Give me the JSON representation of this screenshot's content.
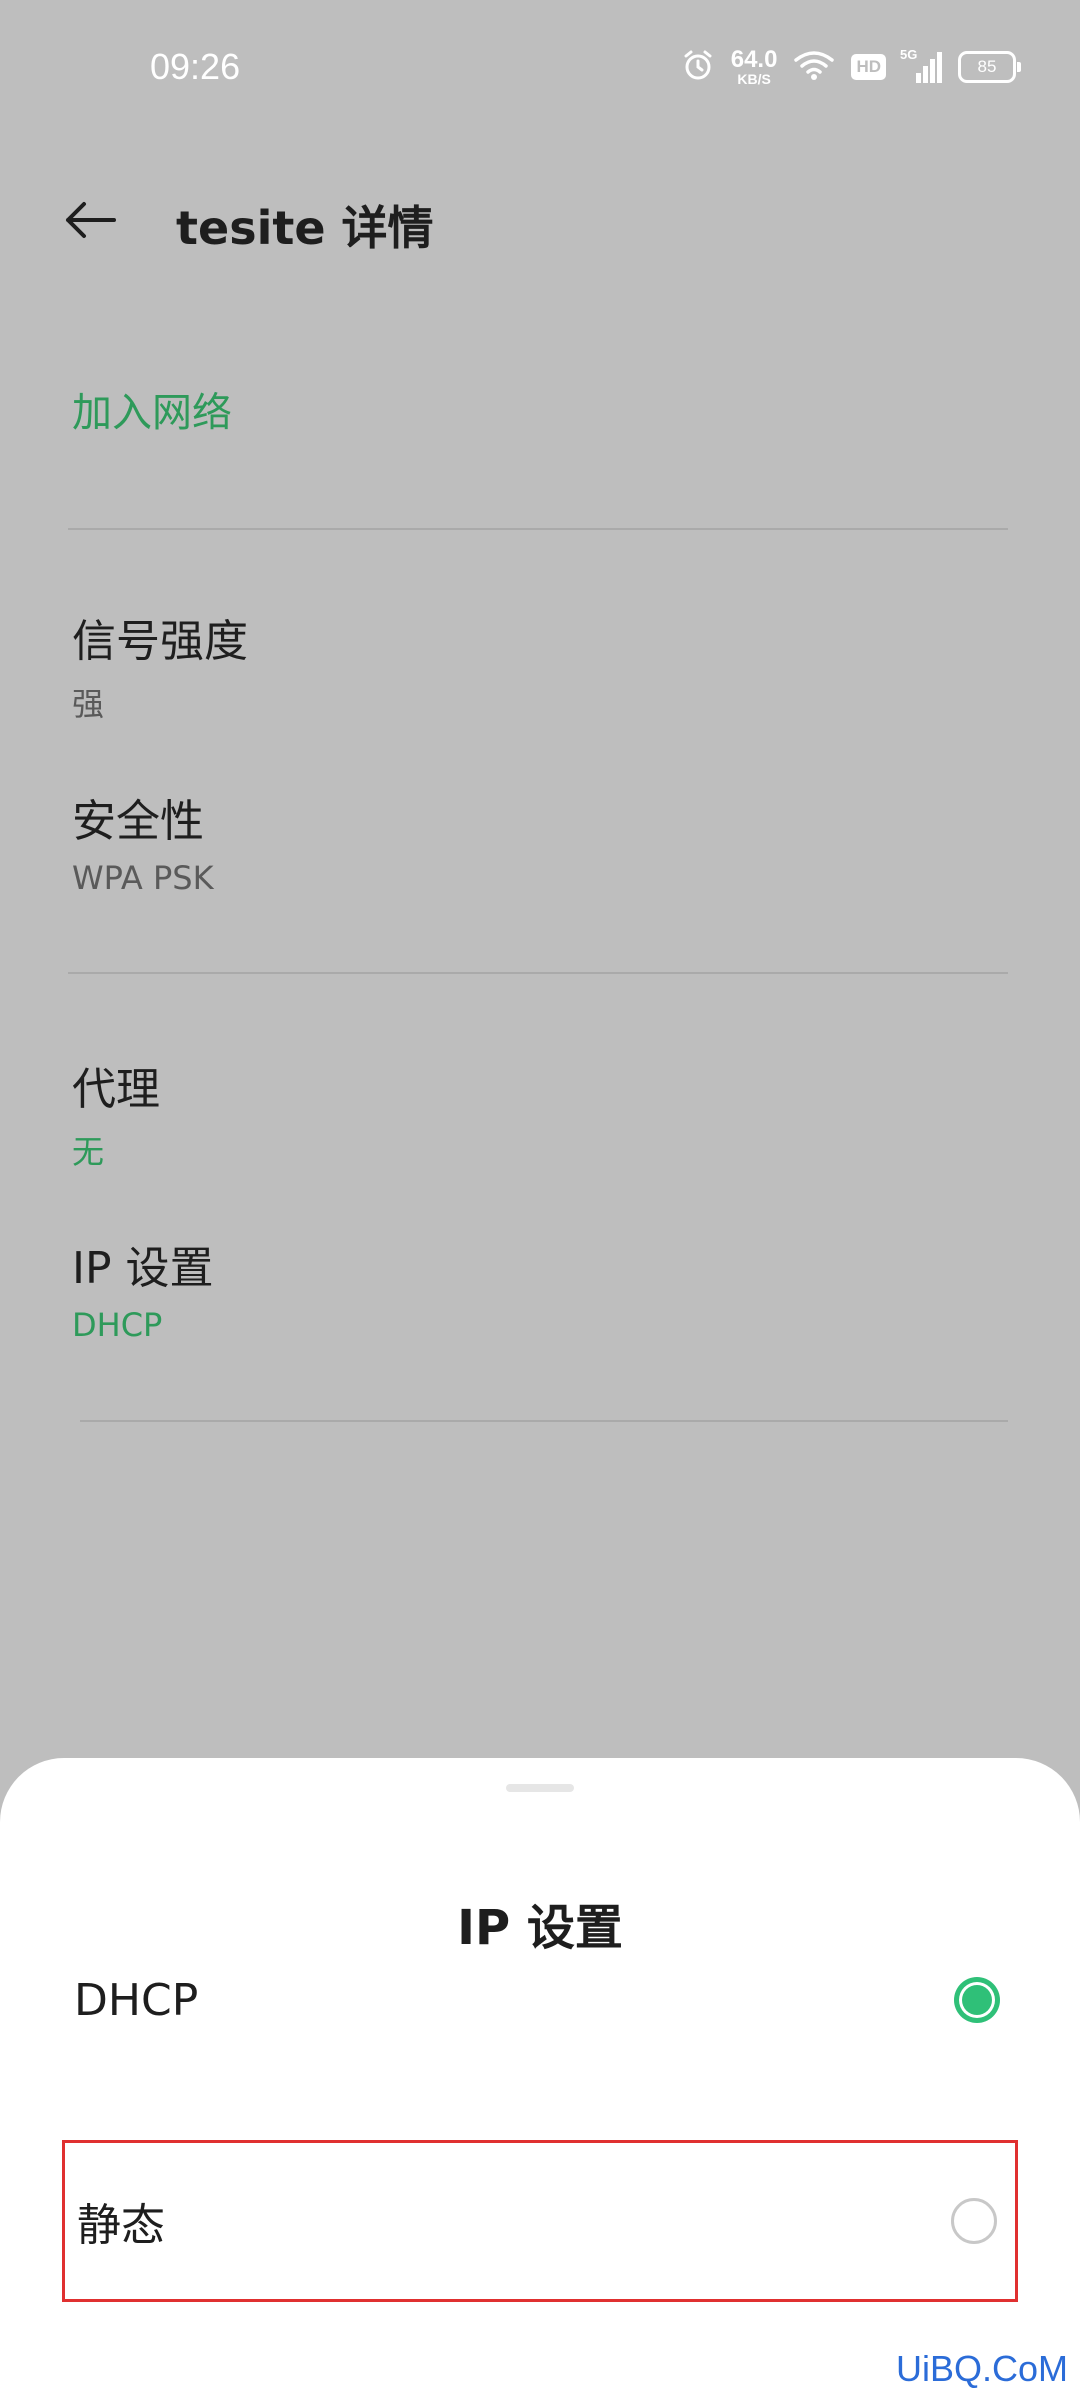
{
  "status_bar": {
    "time": "09:26",
    "net_speed_value": "64.0",
    "net_speed_unit": "KB/S",
    "hd_badge": "HD",
    "network_type": "5G",
    "battery_level": "85"
  },
  "header": {
    "title": "tesite 详情"
  },
  "actions": {
    "join_network": "加入网络"
  },
  "details": {
    "signal_strength": {
      "label": "信号强度",
      "value": "强"
    },
    "security": {
      "label": "安全性",
      "value": "WPA PSK"
    },
    "proxy": {
      "label": "代理",
      "value": "无"
    },
    "ip_settings": {
      "label": "IP 设置",
      "value": "DHCP"
    }
  },
  "sheet": {
    "title": "IP 设置",
    "options": [
      {
        "label": "DHCP",
        "selected": true
      },
      {
        "label": "静态",
        "selected": false
      }
    ]
  },
  "watermark": "UiBQ.CoM",
  "colors": {
    "accent_green": "#2e9a5a",
    "radio_selected": "#2fc078",
    "highlight_border": "#e03030",
    "dim_background": "#bebebe"
  },
  "icons": {
    "back": "arrow-left-icon",
    "alarm": "alarm-icon",
    "wifi": "wifi-icon",
    "signal": "cell-signal-icon",
    "battery": "battery-icon"
  }
}
